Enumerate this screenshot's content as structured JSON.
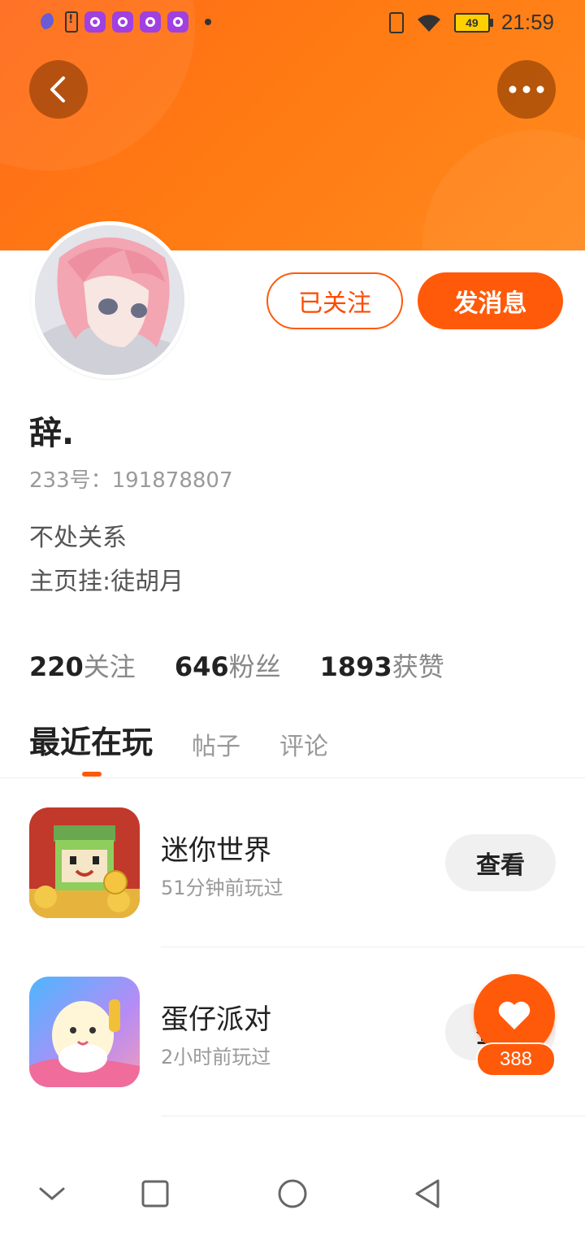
{
  "status_bar": {
    "time": "21:59",
    "battery": "49",
    "icons": [
      "moon-icon",
      "battery-alert-icon",
      "app-notification-icon",
      "vibrate-icon",
      "wifi-icon",
      "battery-icon"
    ]
  },
  "header": {
    "back_icon": "back-arrow-icon",
    "more_icon": "more-dots-icon",
    "accent_color": "#ff5a0a"
  },
  "profile": {
    "name": "辞.",
    "id_label": "233号：191878807",
    "bio_lines": [
      "不处关系",
      "主页挂:徒胡月"
    ],
    "follow_button": "已关注",
    "message_button": "发消息",
    "stats": [
      {
        "num": "220",
        "label": "关注"
      },
      {
        "num": "646",
        "label": "粉丝"
      },
      {
        "num": "1893",
        "label": "获赞"
      }
    ]
  },
  "tabs": [
    {
      "label": "最近在玩",
      "active": true
    },
    {
      "label": "帖子",
      "active": false
    },
    {
      "label": "评论",
      "active": false
    }
  ],
  "games": [
    {
      "name": "迷你世界",
      "time": "51分钟前玩过",
      "button": "查看"
    },
    {
      "name": "蛋仔派对",
      "time": "2小时前玩过",
      "button": "查看"
    }
  ],
  "fab": {
    "count": "388",
    "icon": "heart-icon"
  },
  "nav_bar": {
    "icons": [
      "collapse-chevron-icon",
      "recents-square-icon",
      "home-circle-icon",
      "back-triangle-icon"
    ]
  }
}
